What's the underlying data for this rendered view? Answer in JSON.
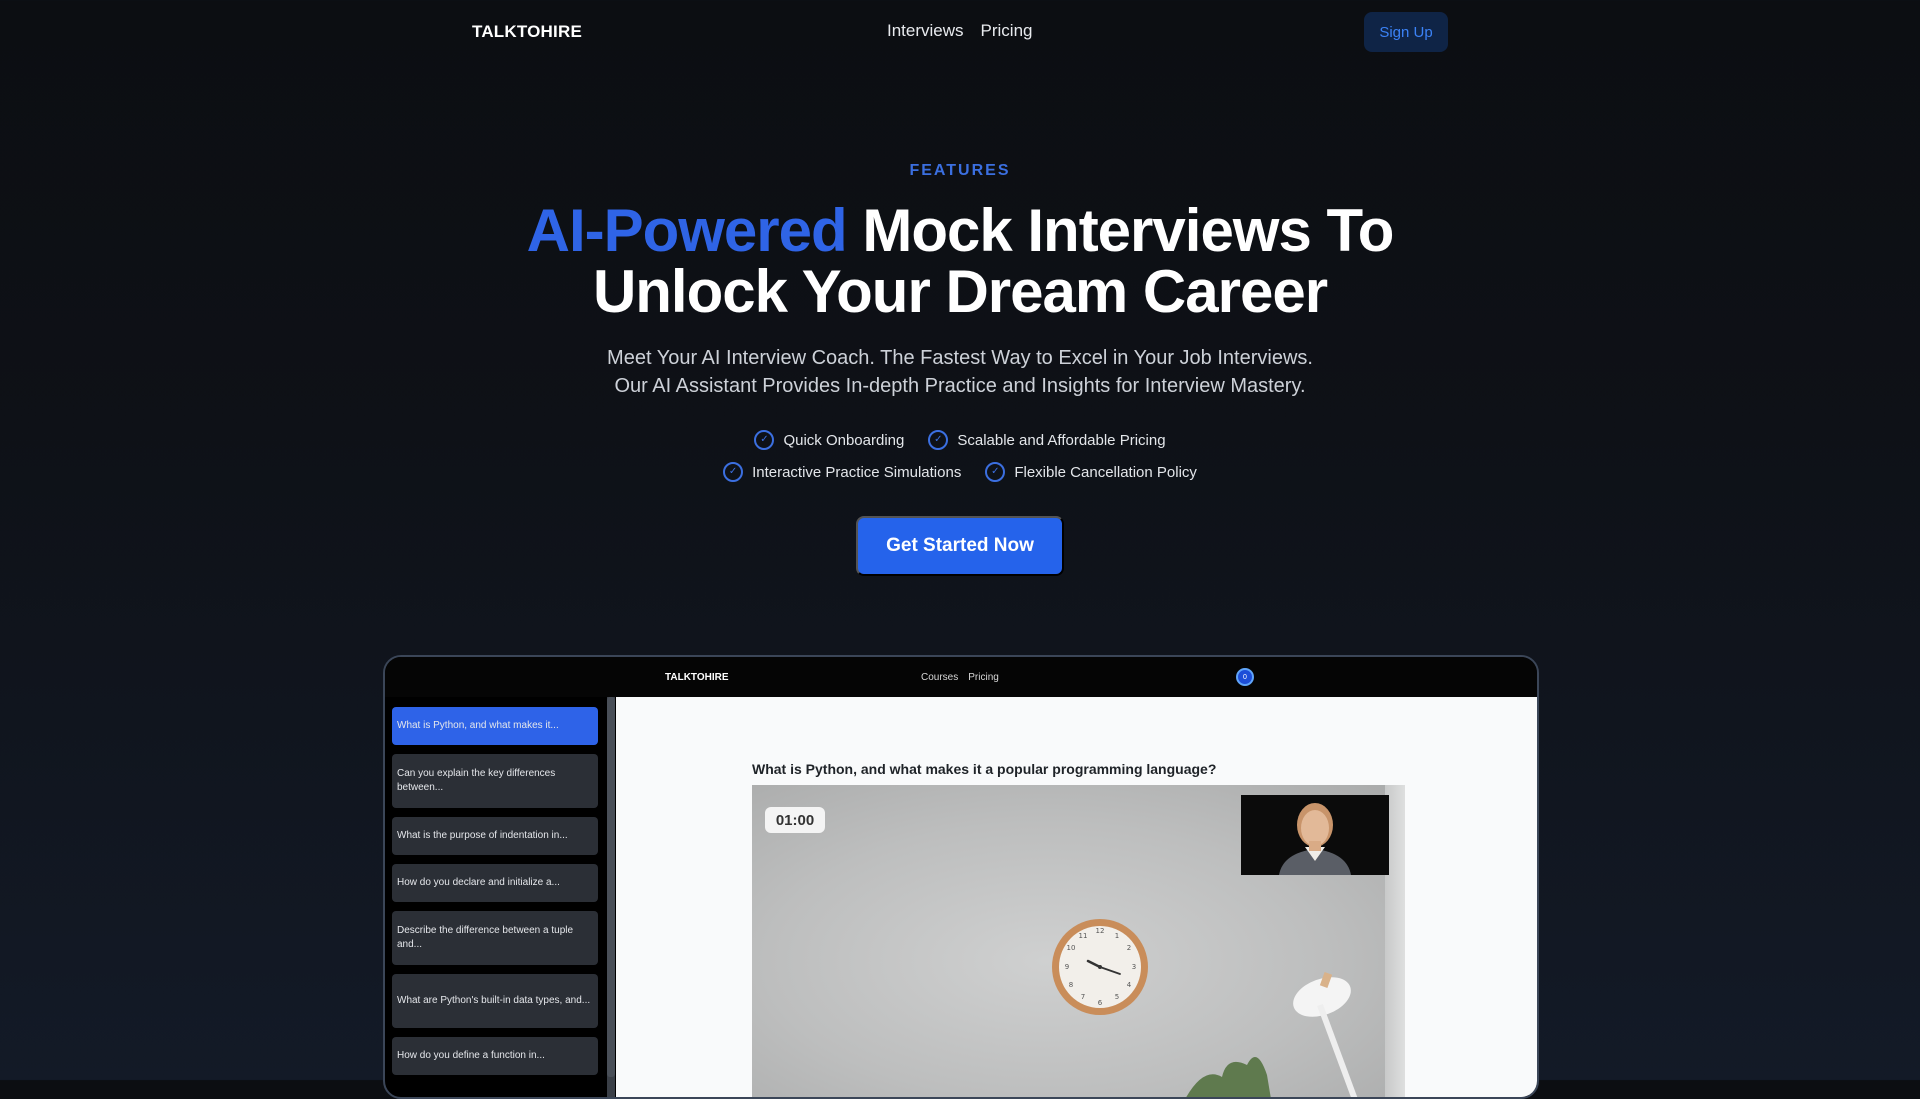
{
  "nav": {
    "logo": "TALKTOHIRE",
    "links": [
      "Interviews",
      "Pricing"
    ],
    "signup_label": "Sign Up"
  },
  "hero": {
    "eyebrow": "FEATURES",
    "title_accent": "AI-Powered",
    "title_line1_rest": " Mock Interviews To",
    "title_line2": "Unlock Your Dream Career",
    "subtitle_line1": "Meet Your AI Interview Coach. The Fastest Way to Excel in Your Job Interviews.",
    "subtitle_line2": "Our AI Assistant Provides In-depth Practice and Insights for Interview Mastery.",
    "features": [
      "Quick Onboarding",
      "Scalable and Affordable Pricing",
      "Interactive Practice Simulations",
      "Flexible Cancellation Policy"
    ],
    "cta_label": "Get Started Now"
  },
  "preview": {
    "logo": "TALKTOHIRE",
    "links": [
      "Courses",
      "Pricing"
    ],
    "avatar_initial": "0",
    "questions": [
      "What is Python, and what makes it...",
      "Can you explain the key differences between...",
      "What is the purpose of indentation in...",
      "How do you declare and initialize a...",
      "Describe the difference between a tuple and...",
      "What are Python's built-in data types, and...",
      "How do you define a function in..."
    ],
    "current_question": "What is Python, and what makes it a popular programming language?",
    "timer": "01:00"
  },
  "colors": {
    "accent": "#2f64e6",
    "cta": "#2563eb",
    "background": "#0e1117"
  }
}
